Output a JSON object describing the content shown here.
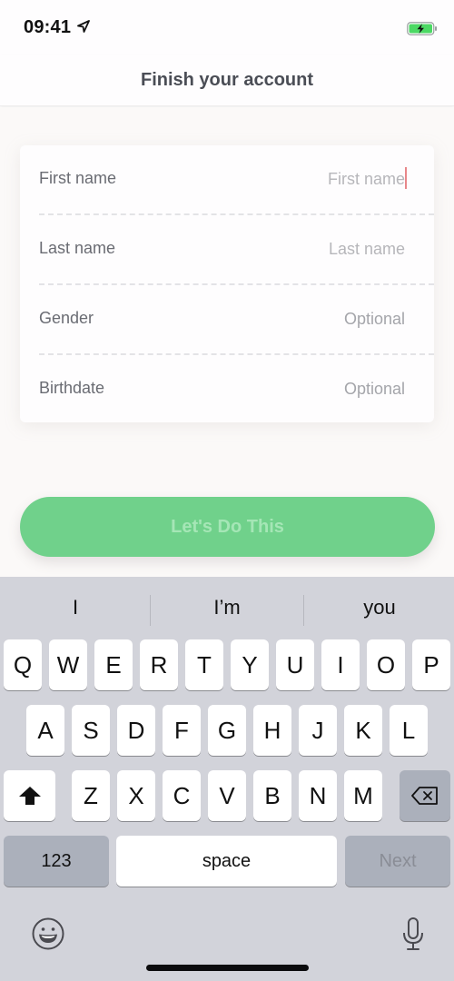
{
  "status_bar": {
    "time": "09:41",
    "location_icon": "location-arrow-icon",
    "battery_icon": "battery-charging-icon",
    "battery_color": "#4cd964"
  },
  "nav": {
    "title": "Finish your account"
  },
  "form": {
    "fields": [
      {
        "label": "First name",
        "placeholder": "First name",
        "value": "",
        "focused": true
      },
      {
        "label": "Last name",
        "placeholder": "Last name",
        "value": ""
      },
      {
        "label": "Gender",
        "placeholder": "Optional",
        "value": ""
      },
      {
        "label": "Birthdate",
        "placeholder": "Optional",
        "value": ""
      }
    ]
  },
  "cta": {
    "label": "Let's Do This",
    "color": "#70d18b",
    "enabled": false
  },
  "keyboard": {
    "suggestions": [
      "I",
      "I’m",
      "you"
    ],
    "rows": [
      [
        "Q",
        "W",
        "E",
        "R",
        "T",
        "Y",
        "U",
        "I",
        "O",
        "P"
      ],
      [
        "A",
        "S",
        "D",
        "F",
        "G",
        "H",
        "J",
        "K",
        "L"
      ],
      [
        "Z",
        "X",
        "C",
        "V",
        "B",
        "N",
        "M"
      ]
    ],
    "shift_icon": "shift-arrow-icon",
    "delete_icon": "backspace-icon",
    "numbers_label": "123",
    "space_label": "space",
    "return_label": "Next",
    "emoji_icon": "emoji-smiley-icon",
    "mic_icon": "microphone-icon"
  }
}
